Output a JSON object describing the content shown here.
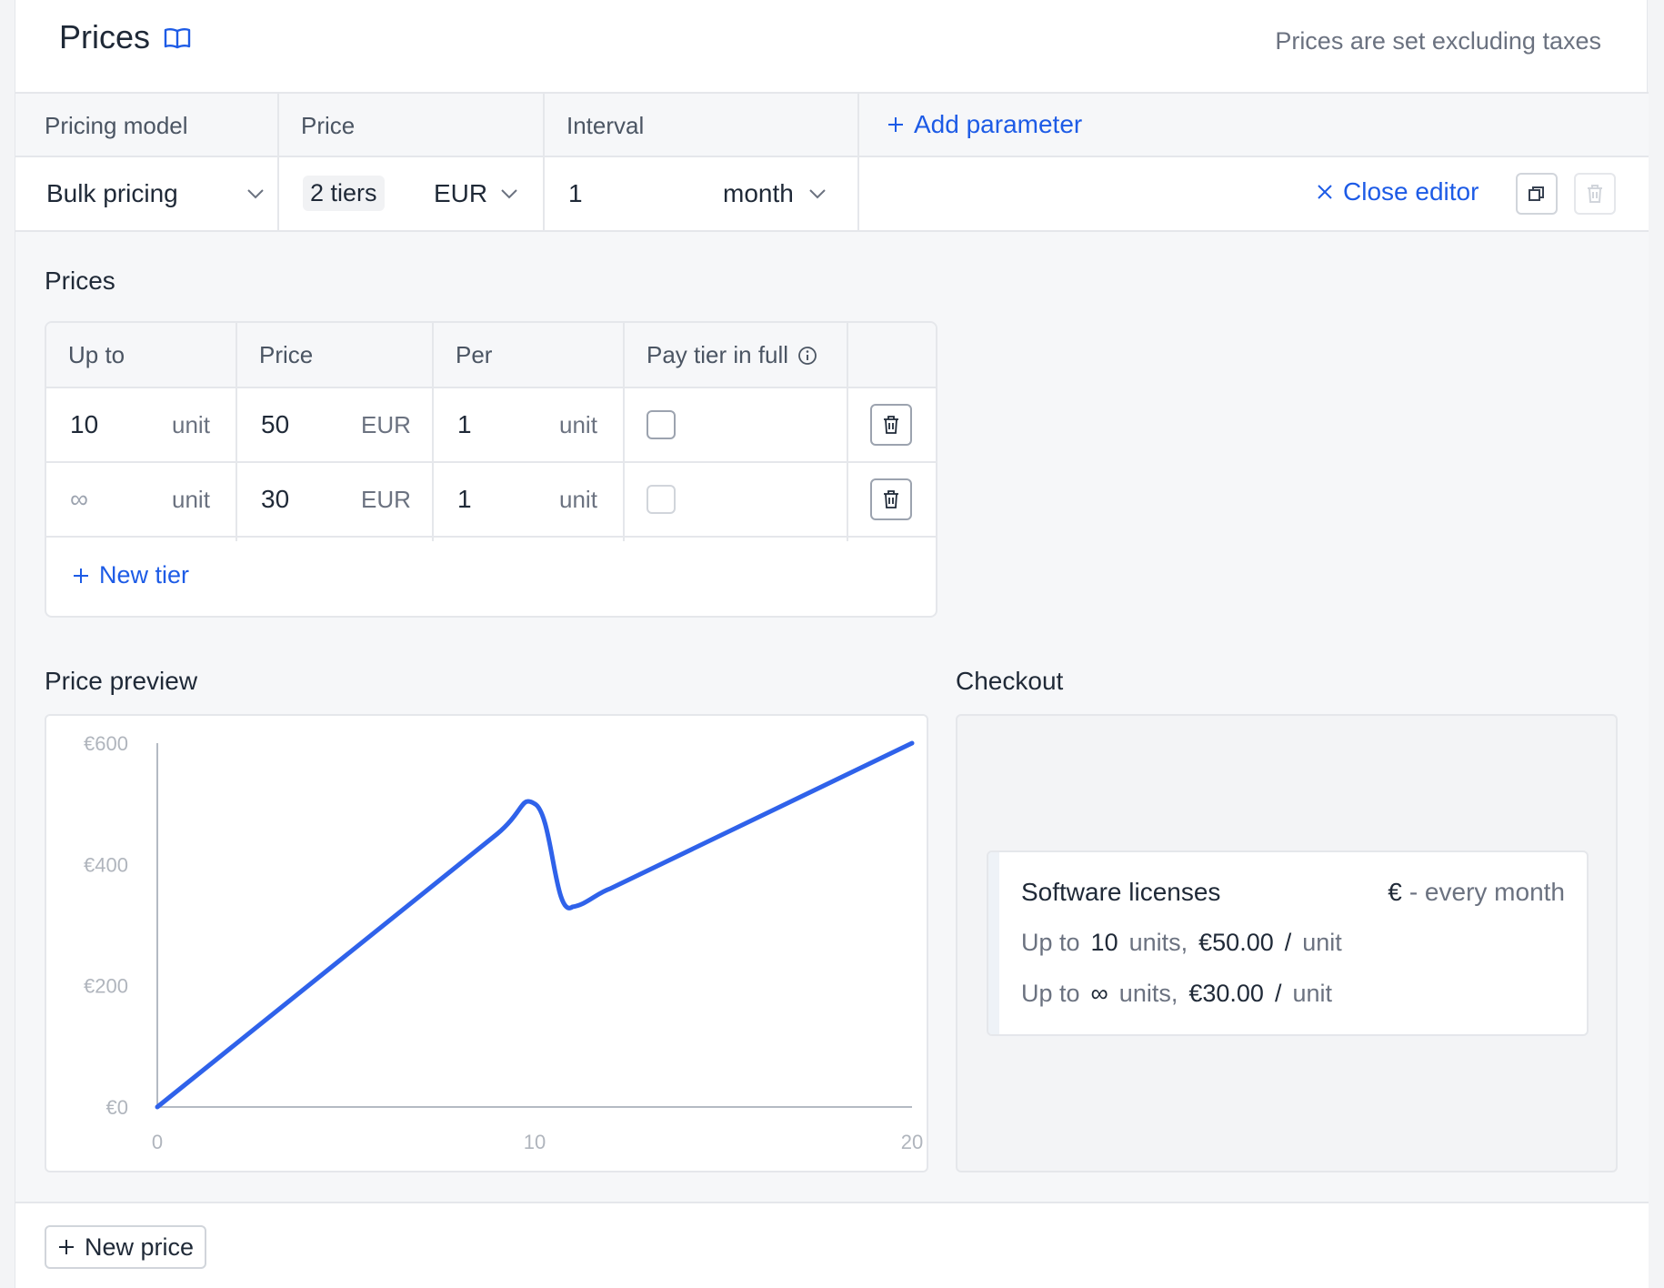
{
  "header": {
    "title": "Prices",
    "note": "Prices are set excluding taxes"
  },
  "params": {
    "headers": [
      "Pricing model",
      "Price",
      "Interval"
    ],
    "add_parameter": "Add parameter",
    "pricing_model": "Bulk pricing",
    "tiers_chip": "2 tiers",
    "currency": "EUR",
    "interval_count": "1",
    "interval_unit": "month",
    "close_editor": "Close editor"
  },
  "prices_section": {
    "title": "Prices",
    "headers": [
      "Up to",
      "Price",
      "Per",
      "Pay tier in full"
    ],
    "rows": [
      {
        "up_to": "10",
        "up_to_unit": "unit",
        "price": "50",
        "price_currency": "EUR",
        "per": "1",
        "per_unit": "unit",
        "pay_in_full": false
      },
      {
        "up_to": "∞",
        "up_to_unit": "unit",
        "price": "30",
        "price_currency": "EUR",
        "per": "1",
        "per_unit": "unit",
        "pay_in_full": false
      }
    ],
    "new_tier": "New tier"
  },
  "preview": {
    "title": "Price preview"
  },
  "chart_data": {
    "type": "line",
    "title": "",
    "xlabel": "",
    "ylabel": "",
    "x_ticks": [
      "0",
      "10",
      "20"
    ],
    "y_ticks": [
      "€0",
      "€200",
      "€400",
      "€600"
    ],
    "xlim": [
      0,
      20
    ],
    "ylim": [
      0,
      600
    ],
    "series": [
      {
        "color": "#2f62ea",
        "x": [
          0,
          9,
          10,
          11,
          12,
          20
        ],
        "y": [
          0,
          450,
          500,
          330,
          360,
          600
        ]
      }
    ]
  },
  "checkout": {
    "title": "Checkout",
    "product": "Software licenses",
    "price_summary_symbol": "€",
    "price_summary_rest": "- every month",
    "lines": [
      {
        "prefix": "Up to",
        "qty": "10",
        "units": "units,",
        "amount": "€50.00",
        "slash": "/",
        "unit": "unit"
      },
      {
        "prefix": "Up to",
        "qty": "∞",
        "units": "units,",
        "amount": "€30.00",
        "slash": "/",
        "unit": "unit"
      }
    ]
  },
  "footer": {
    "new_price": "New price"
  },
  "colors": {
    "accent": "#1d5be6",
    "chart_line": "#2f62ea",
    "border": "#e5e7eb"
  }
}
